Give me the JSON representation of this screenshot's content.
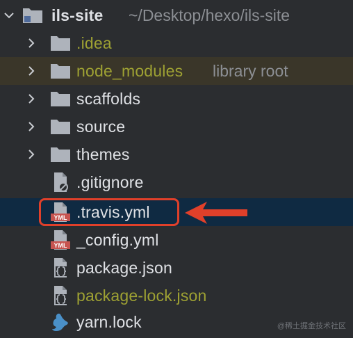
{
  "root": {
    "name": "ils-site",
    "path": "~/Desktop/hexo/ils-site"
  },
  "items": [
    {
      "name": ".idea",
      "type": "folder",
      "color": "#9ea133"
    },
    {
      "name": "node_modules",
      "type": "folder",
      "hint": "library root",
      "color": "#9ea133"
    },
    {
      "name": "scaffolds",
      "type": "folder",
      "color": "#dfe1e5"
    },
    {
      "name": "source",
      "type": "folder",
      "color": "#dfe1e5"
    },
    {
      "name": "themes",
      "type": "folder",
      "color": "#dfe1e5"
    },
    {
      "name": ".gitignore",
      "type": "file",
      "icon": "ignore-file-icon",
      "color": "#dfe1e5"
    },
    {
      "name": ".travis.yml",
      "type": "file",
      "icon": "yml-file-icon",
      "color": "#dfe1e5",
      "selected": true
    },
    {
      "name": "_config.yml",
      "type": "file",
      "icon": "yml-file-icon",
      "color": "#dfe1e5"
    },
    {
      "name": "package.json",
      "type": "file",
      "icon": "json-file-icon",
      "color": "#dfe1e5"
    },
    {
      "name": "package-lock.json",
      "type": "file",
      "icon": "json-file-icon",
      "color": "#9ea133"
    },
    {
      "name": "yarn.lock",
      "type": "file",
      "icon": "yarn-icon",
      "color": "#dfe1e5"
    }
  ],
  "icon_badges": {
    "yml": "YML"
  },
  "watermark": "@稀土掘金技术社区",
  "colors": {
    "background": "#2b2d30",
    "selection": "#0f2a42",
    "library_row": "#3a3629",
    "highlight_annotation": "#e0402a",
    "modified_text": "#9ea133"
  }
}
